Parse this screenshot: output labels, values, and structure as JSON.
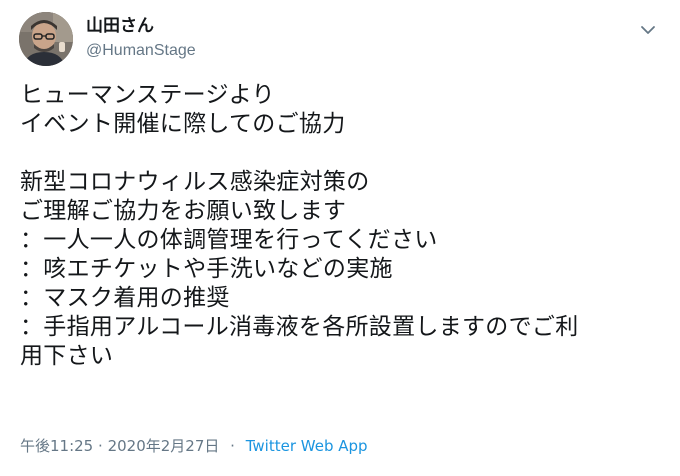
{
  "user": {
    "display_name": "山田さん",
    "username": "@HumanStage"
  },
  "icons": {
    "menu": "chevron-down-icon",
    "avatar": "profile-photo"
  },
  "tweet": {
    "lines": [
      "ヒューマンステージより",
      "イベント開催に際してのご協力",
      "",
      "新型コロナウィルス感染症対策の",
      "ご理解ご協力をお願い致します",
      "：一人一人の体調管理を行ってください",
      "：咳エチケットや手洗いなどの実施",
      "：マスク着用の推奨",
      "：手指用アルコール消毒液を各所設置しますのでご利",
      "用下さい"
    ]
  },
  "meta": {
    "time": "午後11:25",
    "separator": "·",
    "date": "2020年2月27日",
    "source": "Twitter Web App"
  },
  "colors": {
    "text": "#14171a",
    "secondary": "#657786",
    "link": "#1b95e0"
  }
}
